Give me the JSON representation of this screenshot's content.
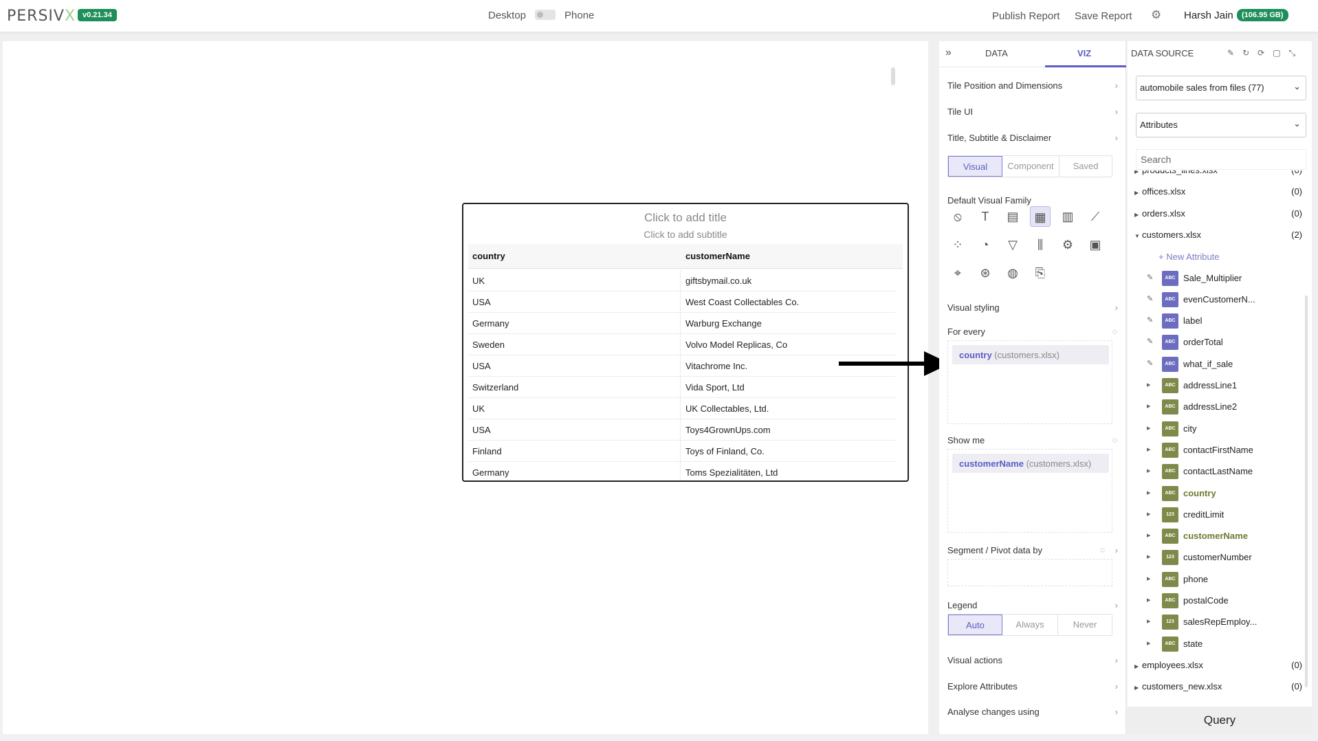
{
  "topbar": {
    "logo_main": "PERSIV",
    "logo_x": "X",
    "version": "v0.21.34",
    "mode_desktop": "Desktop",
    "mode_phone": "Phone",
    "publish": "Publish Report",
    "save": "Save Report",
    "user": "Harsh Jain",
    "storage": "(106.95 GB)"
  },
  "tile": {
    "title": "Click to add title",
    "subtitle": "Click to add subtitle",
    "columns": [
      "country",
      "customerName"
    ],
    "rows": [
      [
        "UK",
        "giftsbymail.co.uk"
      ],
      [
        "USA",
        "West Coast Collectables Co."
      ],
      [
        "Germany",
        "Warburg Exchange"
      ],
      [
        "Sweden",
        "Volvo Model Replicas, Co"
      ],
      [
        "USA",
        "Vitachrome Inc."
      ],
      [
        "Switzerland",
        "Vida Sport, Ltd"
      ],
      [
        "UK",
        "UK Collectables, Ltd."
      ],
      [
        "USA",
        "Toys4GrownUps.com"
      ],
      [
        "Finland",
        "Toys of Finland, Co."
      ],
      [
        "Germany",
        "Toms Spezialitäten, Ltd"
      ]
    ]
  },
  "viz": {
    "tabs": [
      "DATA",
      "VIZ"
    ],
    "items": {
      "tile_position": "Tile Position and Dimensions",
      "tile_ui": "Tile UI",
      "title_subtitle": "Title, Subtitle & Disclaimer",
      "default_family": "Default Visual Family",
      "visual_styling": "Visual styling",
      "for_every": "For every",
      "show_me": "Show me",
      "segment": "Segment / Pivot data by",
      "legend": "Legend",
      "visual_actions": "Visual actions",
      "explore": "Explore Attributes",
      "analyse": "Analyse changes using"
    },
    "mode_seg": [
      "Visual",
      "Component",
      "Saved"
    ],
    "legend_seg": [
      "Auto",
      "Always",
      "Never"
    ],
    "for_every_chip": {
      "name": "country",
      "source": "(customers.xlsx)"
    },
    "show_me_chip": {
      "name": "customerName",
      "source": "(customers.xlsx)"
    },
    "visual_icons": [
      "none-icon",
      "text-icon",
      "kpi-card-icon",
      "table-icon",
      "bar-chart-icon",
      "line-chart-icon",
      "scatter-icon",
      "pie-chart-icon",
      "funnel-icon",
      "boxplot-icon",
      "gear-icon",
      "tiles-icon",
      "map-icon",
      "network-icon",
      "gauge-icon",
      "js-file-icon"
    ]
  },
  "datasource": {
    "header": "DATA SOURCE",
    "source": "automobile sales from files (77)",
    "view": "Attributes",
    "search_placeholder": "Search",
    "files_top": [
      {
        "name": "products_lines.xlsx",
        "count": "(0)"
      },
      {
        "name": "offices.xlsx",
        "count": "(0)"
      },
      {
        "name": "orders.xlsx",
        "count": "(0)"
      },
      {
        "name": "customers.xlsx",
        "count": "(2)"
      }
    ],
    "new_attribute": "+ New Attribute",
    "attributes": [
      {
        "name": "Sale_Multiplier",
        "type": "ABC",
        "color": "purple",
        "edit": true
      },
      {
        "name": "evenCustomerN...",
        "type": "ABC",
        "color": "purple",
        "edit": true
      },
      {
        "name": "label",
        "type": "ABC",
        "color": "purple",
        "edit": true
      },
      {
        "name": "orderTotal",
        "type": "ABC",
        "color": "purple",
        "edit": true
      },
      {
        "name": "what_if_sale",
        "type": "ABC",
        "color": "purple",
        "edit": true
      },
      {
        "name": "addressLine1",
        "type": "ABC",
        "color": "green"
      },
      {
        "name": "addressLine2",
        "type": "ABC",
        "color": "green"
      },
      {
        "name": "city",
        "type": "ABC",
        "color": "green"
      },
      {
        "name": "contactFirstName",
        "type": "ABC",
        "color": "green"
      },
      {
        "name": "contactLastName",
        "type": "ABC",
        "color": "green"
      },
      {
        "name": "country",
        "type": "ABC",
        "color": "green",
        "bold": true
      },
      {
        "name": "creditLimit",
        "type": "123",
        "color": "green"
      },
      {
        "name": "customerName",
        "type": "ABC",
        "color": "green",
        "bold": true
      },
      {
        "name": "customerNumber",
        "type": "123",
        "color": "green"
      },
      {
        "name": "phone",
        "type": "ABC",
        "color": "green"
      },
      {
        "name": "postalCode",
        "type": "ABC",
        "color": "green"
      },
      {
        "name": "salesRepEmploy...",
        "type": "123",
        "color": "green"
      },
      {
        "name": "state",
        "type": "ABC",
        "color": "green"
      }
    ],
    "files_bottom": [
      {
        "name": "employees.xlsx",
        "count": "(0)"
      },
      {
        "name": "customers_new.xlsx",
        "count": "(0)"
      }
    ],
    "query": "Query"
  }
}
